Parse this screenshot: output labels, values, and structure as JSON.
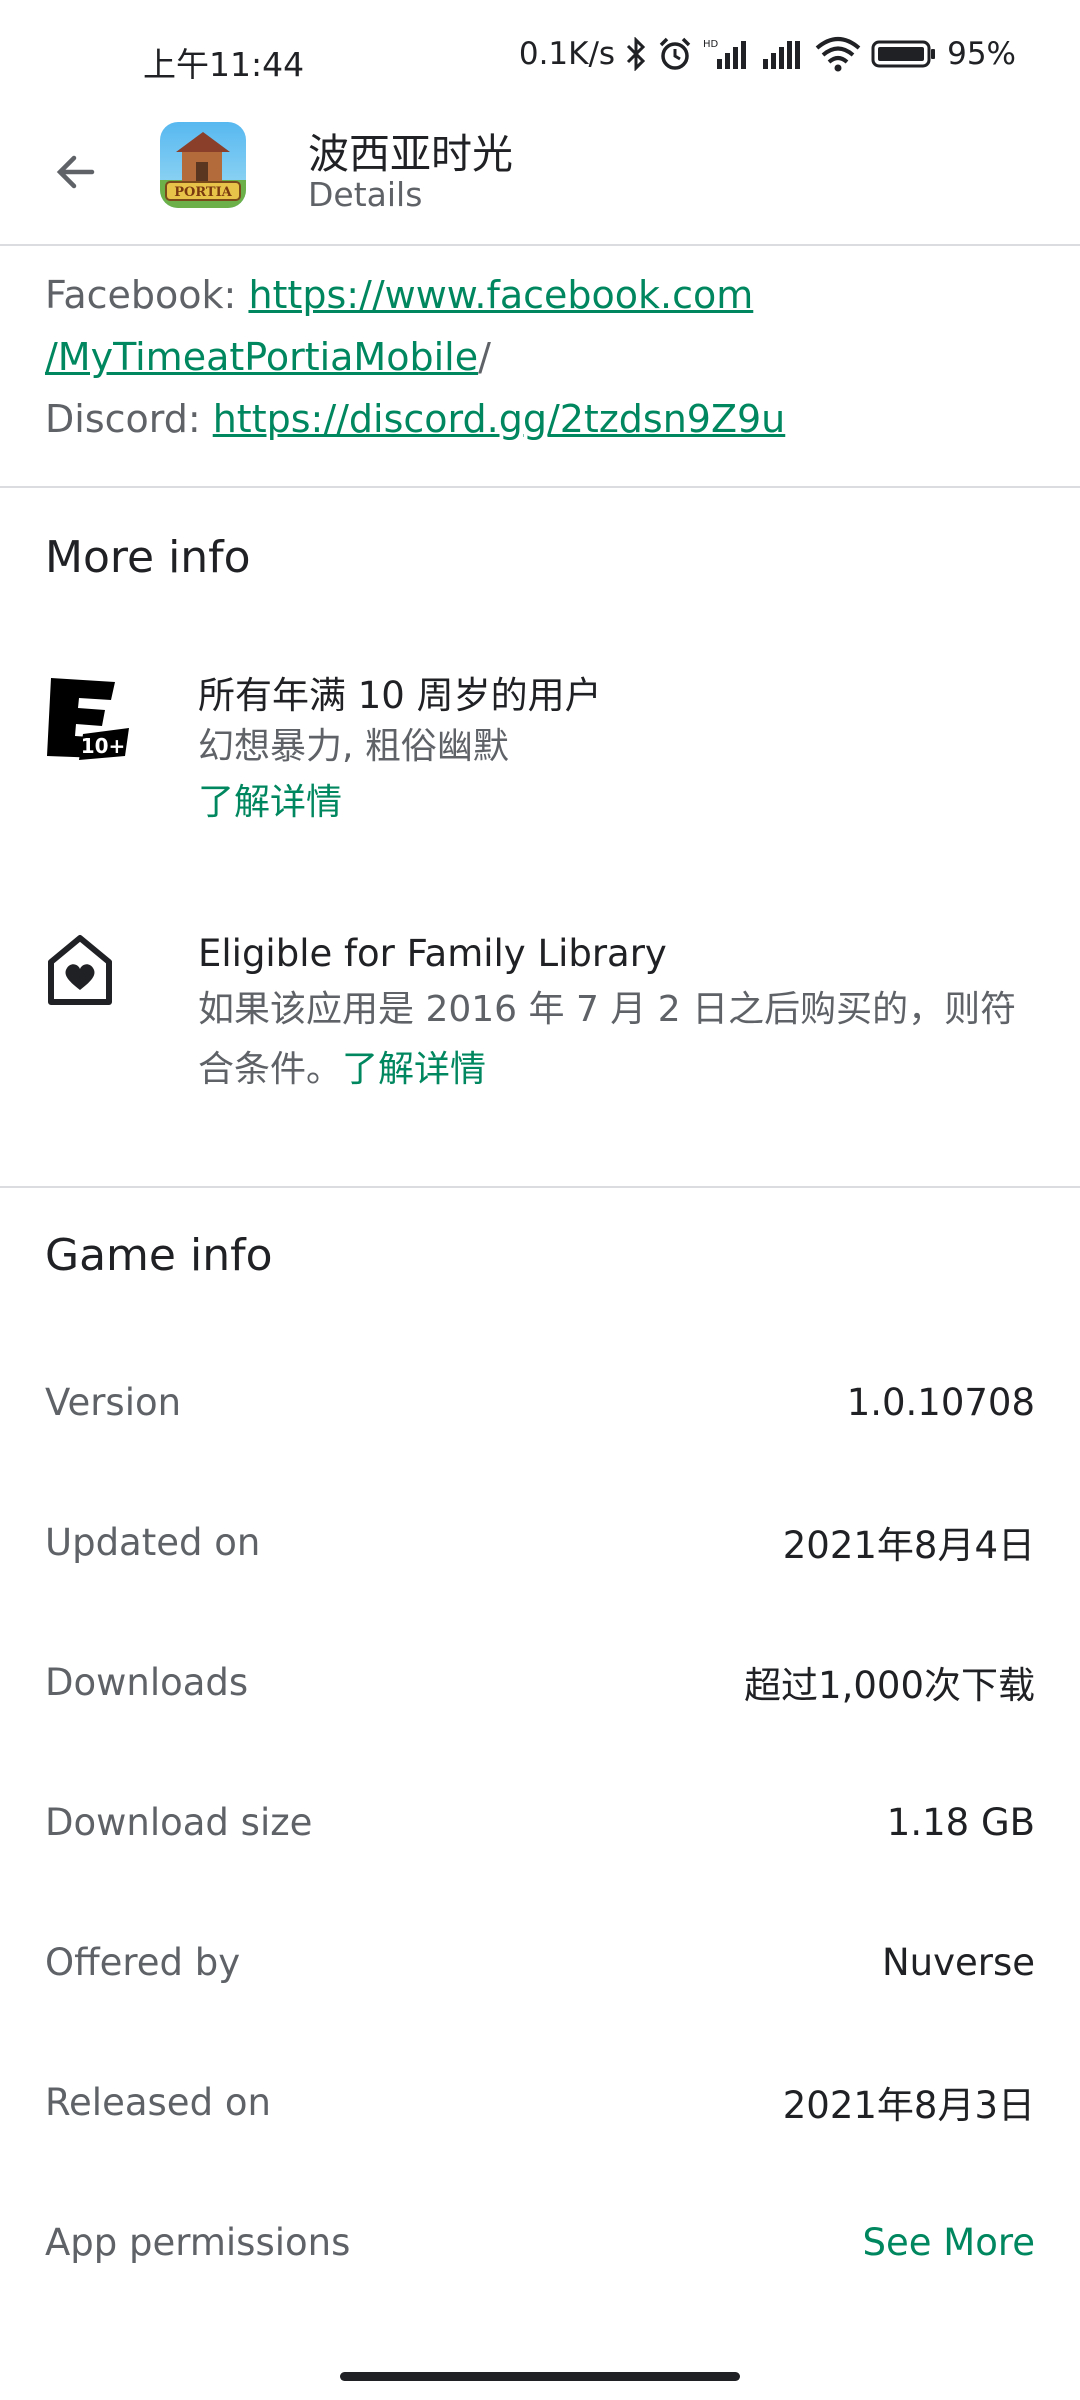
{
  "status_bar": {
    "time": "上午11:44",
    "net_speed": "0.1K/s",
    "battery": "95%"
  },
  "app_bar": {
    "title": "波西亚时光",
    "subtitle": "Details",
    "icon_text": "PORTIA"
  },
  "links": {
    "facebook_label": "Facebook: ",
    "facebook_url_1": "https://www.facebook.com",
    "facebook_url_2": "/MyTimeatPortiaMobile",
    "facebook_trail": "/",
    "discord_label": "Discord: ",
    "discord_url": "https://discord.gg/2tzdsn9Z9u"
  },
  "more_info": {
    "title": "More info",
    "rating": {
      "icon_text": "10+",
      "primary": "所有年满 10 周岁的用户",
      "secondary": "幻想暴力, 粗俗幽默",
      "link": "了解详情"
    },
    "family": {
      "primary": "Eligible for Family Library",
      "secondary": "如果该应用是 2016 年 7 月 2 日之后购买的，则符合条件。",
      "link": "了解详情"
    }
  },
  "game_info": {
    "title": "Game info",
    "rows": [
      {
        "label": "Version",
        "value": "1.0.10708"
      },
      {
        "label": "Updated on",
        "value": "2021年8月4日"
      },
      {
        "label": "Downloads",
        "value": "超过1,000次下载"
      },
      {
        "label": "Download size",
        "value": "1.18 GB"
      },
      {
        "label": "Offered by",
        "value": "Nuverse"
      },
      {
        "label": "Released on",
        "value": "2021年8月3日"
      },
      {
        "label": "App permissions",
        "value": "See More"
      }
    ]
  },
  "colors": {
    "accent": "#01875f",
    "text_primary": "#202124",
    "text_secondary": "#5f6368",
    "divider": "#dadce0"
  }
}
